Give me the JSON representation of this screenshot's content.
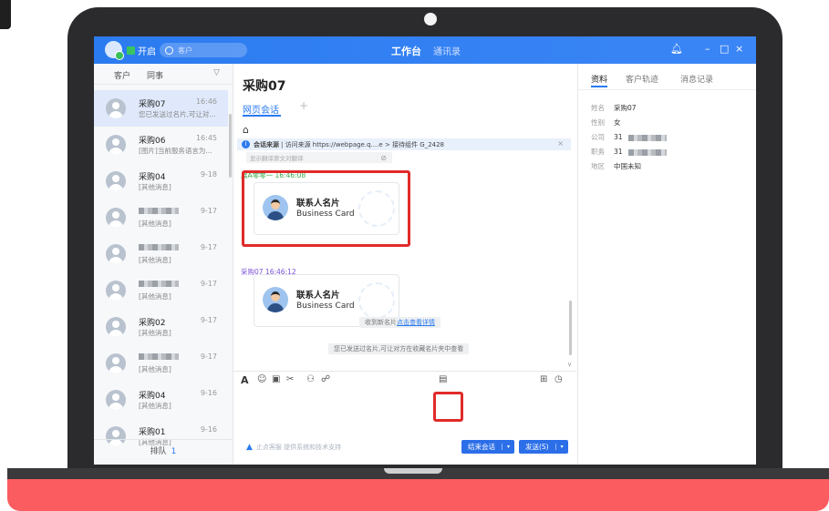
{
  "title_bar": {
    "status_label": "开启",
    "search_placeholder": "客户",
    "tab_workbench": "工作台",
    "tab_contacts": "通讯录",
    "bell_icon": "bell-icon",
    "minimize": "–",
    "maximize": "□",
    "close": "×"
  },
  "left_panel": {
    "tabs": [
      "客户",
      "同事"
    ],
    "conversations": [
      {
        "name": "采购07",
        "time": "16:46",
        "preview": "您已发送过名片,可让对..."
      },
      {
        "name": "采购06",
        "time": "16:45",
        "preview": "[图片]当前服务语言为..."
      },
      {
        "name": "采购04",
        "time": "9-18",
        "preview": "[其他消息]"
      },
      {
        "name": "",
        "time": "9-17",
        "preview": "[其他消息]"
      },
      {
        "name": "",
        "time": "9-17",
        "preview": "[其他消息]"
      },
      {
        "name": "",
        "time": "9-17",
        "preview": "[其他消息]"
      },
      {
        "name": "采购02",
        "time": "9-17",
        "preview": "[其他消息]"
      },
      {
        "name": "",
        "time": "9-17",
        "preview": "[其他消息]"
      },
      {
        "name": "采购04",
        "time": "9-16",
        "preview": "[其他消息]"
      },
      {
        "name": "采购01",
        "time": "9-16",
        "preview": "[其他消息]"
      }
    ],
    "queue_label": "排队",
    "queue_count": "1"
  },
  "chat": {
    "title": "采购07",
    "tab": "网页会话",
    "add": "+",
    "source_label": "会话来源",
    "source_text": "| 访问来源 https://webpage.q....e > 接待组件 G_2428",
    "translate_text": "显示翻译原文对翻译",
    "sender1": "展A零零一 16:46:08",
    "sender2": "采购07 16:46:12",
    "card_title": "联系人名片",
    "card_subtitle": "Business Card",
    "sys_msg1_prefix": "收到新名片",
    "sys_msg1_link": "点击查看详情",
    "sys_msg2": "您已发送过名片,可让对方在收藏名片夹中查看",
    "toolbar_icons": [
      "font-icon",
      "emoji-icon",
      "image-icon",
      "scissors-icon",
      "transfer-icon",
      "link-icon",
      "business-card-icon",
      "quick-reply-icon",
      "history-icon"
    ],
    "footer_note": "止点客服 提供系统和技术支持",
    "end_button": "结束会话",
    "send_button": "发送(S)"
  },
  "right_panel": {
    "tabs": [
      "资料",
      "客户轨迹",
      "消息记录"
    ],
    "fields": [
      {
        "label": "姓名",
        "value": "采购07"
      },
      {
        "label": "性别",
        "value": "女"
      },
      {
        "label": "公司",
        "value": "31"
      },
      {
        "label": "职务",
        "value": "31"
      },
      {
        "label": "地区",
        "value": "中国未知"
      }
    ]
  },
  "colors": {
    "brand": "#2b7bf0",
    "highlight": "#e02a2a",
    "base": "#fb5c5f"
  }
}
